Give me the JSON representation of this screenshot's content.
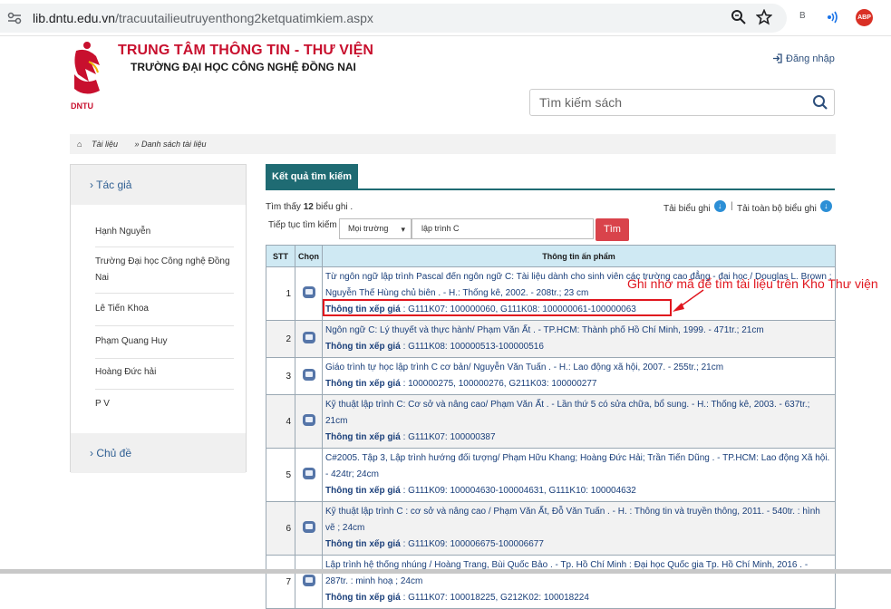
{
  "browser": {
    "url_host": "lib.dntu.edu.vn",
    "url_path": "/tracuutailieutruyenthong2ketquatimkiem.aspx",
    "ext_b_label": "B",
    "ext_abp_label": "ABP"
  },
  "header": {
    "logo_text": "DNTU",
    "title": "TRUNG TÂM THÔNG TIN - THƯ VIỆN",
    "subtitle": "TRƯỜNG ĐẠI HỌC CÔNG NGHỆ ĐỒNG NAI",
    "login_label": "Đăng nhập",
    "search_placeholder": "Tìm kiếm sách"
  },
  "breadcrumb": {
    "home": "Tài liệu",
    "current": "Danh sách tài liệu"
  },
  "sidebar": {
    "author_heading": "› Tác giả",
    "items": [
      {
        "label": "Hạnh Nguyễn"
      },
      {
        "label": "Trường Đại học Công nghệ Đồng Nai"
      },
      {
        "label": "Lê Tiến Khoa"
      },
      {
        "label": "Phạm Quang Huy"
      },
      {
        "label": "Hoàng Đức hải"
      },
      {
        "label": "P V"
      }
    ],
    "topic_heading": "› Chủ đề"
  },
  "results": {
    "tab_label": "Kết quả tìm kiếm",
    "found_prefix": "Tìm thấy",
    "found_count": "12",
    "found_suffix": "biểu ghi .",
    "download_selected": "Tải biểu ghi",
    "download_all": "Tải toàn bộ biểu ghi",
    "separator": "|",
    "continue_label": "Tiếp tục tìm kiếm :",
    "environment_select": "Mọi trường",
    "keyword": "lập trình C",
    "find_button": "Tìm",
    "columns": {
      "stt": "STT",
      "chon": "Chọn",
      "info": "Thông tin ấn phẩm"
    },
    "call_label": "Thông tin xếp giá",
    "rows": [
      {
        "stt": "1",
        "pub": "Từ ngôn ngữ lập trình Pascal đến ngôn ngữ C: Tài liệu dành cho sinh viên các trường cao đẳng - đại học / Douglas L. Brown ; Nguyễn Thế Hùng chủ biên . - H.: Thống kê, 2002. - 208tr.; 23 cm",
        "call": ": G111K07: 100000060, G111K08: 100000061-100000063"
      },
      {
        "stt": "2",
        "pub": "Ngôn ngữ C: Lý thuyết và thực hành/ Phạm Văn Ất . - TP.HCM: Thành phố Hồ Chí Minh, 1999. - 471tr.; 21cm",
        "call": ": G111K08: 100000513-100000516"
      },
      {
        "stt": "3",
        "pub": "Giáo trình tự học lập trình C cơ bản/ Nguyễn Văn Tuấn . - H.: Lao động xã hội, 2007. - 255tr.; 21cm",
        "call": ": 100000275, 100000276, G211K03: 100000277"
      },
      {
        "stt": "4",
        "pub": "Kỹ thuật lập trình C: Cơ sở và nâng cao/ Phạm Văn Ất . - Lần thứ 5 có sửa chữa, bổ sung. - H.: Thống kê, 2003. - 637tr.; 21cm",
        "call": ": G111K07: 100000387"
      },
      {
        "stt": "5",
        "pub": "C#2005. Tập 3, Lập trình hướng đối tượng/ Phạm Hữu Khang; Hoàng Đức Hải; Trần Tiến Dũng . - TP.HCM: Lao động Xã hội. - 424tr; 24cm",
        "call": ": G111K09: 100004630-100004631, G111K10: 100004632"
      },
      {
        "stt": "6",
        "pub": "Kỹ thuật lập trình C : cơ sở và nâng cao / Phạm Văn Ất, Đỗ Văn Tuấn . - H. : Thông tin và truyền thông, 2011. - 540tr. : hình vẽ ; 24cm",
        "call": ": G111K09: 100006675-100006677"
      },
      {
        "stt": "7",
        "pub": "Lập trình hệ thống nhúng / Hoàng Trang, Bùi Quốc Bảo . - Tp. Hồ Chí Minh : Đại học Quốc gia Tp. Hồ Chí Minh, 2016 . - 287tr. : minh hoạ ; 24cm",
        "call": ": G111K07: 100018225, G212K02: 100018224"
      }
    ]
  },
  "annotation": {
    "text": "Ghi nhớ mã để tìm tài liệu trên Kho Thư viện",
    "color": "#e0161e"
  }
}
